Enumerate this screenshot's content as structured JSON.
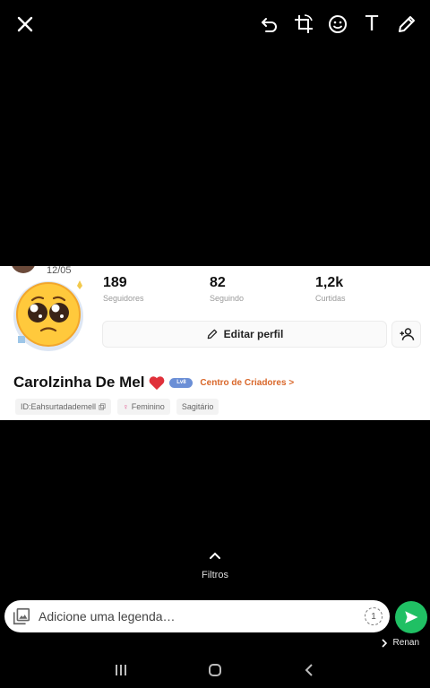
{
  "toolbar": {
    "close_icon": "close-icon",
    "undo_icon": "undo-icon",
    "crop_icon": "crop-rotate-icon",
    "sticker_icon": "emoji-icon",
    "text_icon": "text-icon",
    "text_glyph": "T",
    "draw_icon": "pencil-icon"
  },
  "profile": {
    "birthday": "12/05",
    "stats": [
      {
        "value": "189",
        "label": "Seguidores"
      },
      {
        "value": "82",
        "label": "Seguindo"
      },
      {
        "value": "1,2k",
        "label": "Curtidas"
      }
    ],
    "edit_label": "Editar perfil",
    "name": "Carolzinha De Mel",
    "level_badge": "Lv8",
    "creator_center": "Centro de Criadores >",
    "tags": [
      {
        "label": "ID:Eahsurtadademell",
        "icon": "copy-icon"
      },
      {
        "label": "Feminino",
        "icon": "female-icon"
      },
      {
        "label": "Sagitário",
        "icon": ""
      }
    ]
  },
  "filters": {
    "label": "Filtros",
    "icon": "chevron-up-icon"
  },
  "caption": {
    "placeholder": "Adicione uma legenda…",
    "view_once_label": "1",
    "gallery_icon": "gallery-icon",
    "send_icon": "send-icon"
  },
  "recipient": {
    "name": "Renan"
  },
  "colors": {
    "background": "#000000",
    "send": "#20c064",
    "creator_center": "#d9672a",
    "heart": "#e0303a"
  }
}
